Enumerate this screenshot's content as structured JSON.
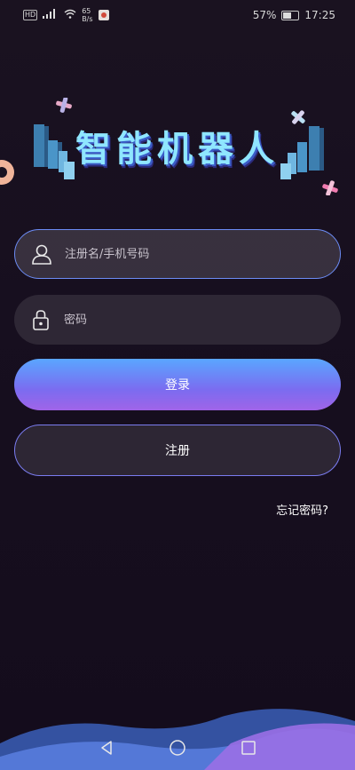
{
  "status_bar": {
    "hd_label": "HD",
    "signal": "⁴⁶",
    "speed_value": "65",
    "speed_unit": "B/s",
    "battery": "57%",
    "time": "17:25"
  },
  "banner": {
    "title": "智能机器人"
  },
  "form": {
    "username_placeholder": "注册名/手机号码",
    "password_placeholder": "密码"
  },
  "buttons": {
    "login_label": "登录",
    "register_label": "注册"
  },
  "links": {
    "forgot_password": "忘记密码?"
  },
  "icons": [
    "user-icon",
    "lock-icon",
    "back-icon",
    "home-icon",
    "recent-apps-icon",
    "wifi-icon",
    "battery-icon"
  ],
  "colors": {
    "accent_blue": "#5aa6ff",
    "accent_purple": "#a064e8",
    "field_border": "#6c8cf5"
  }
}
